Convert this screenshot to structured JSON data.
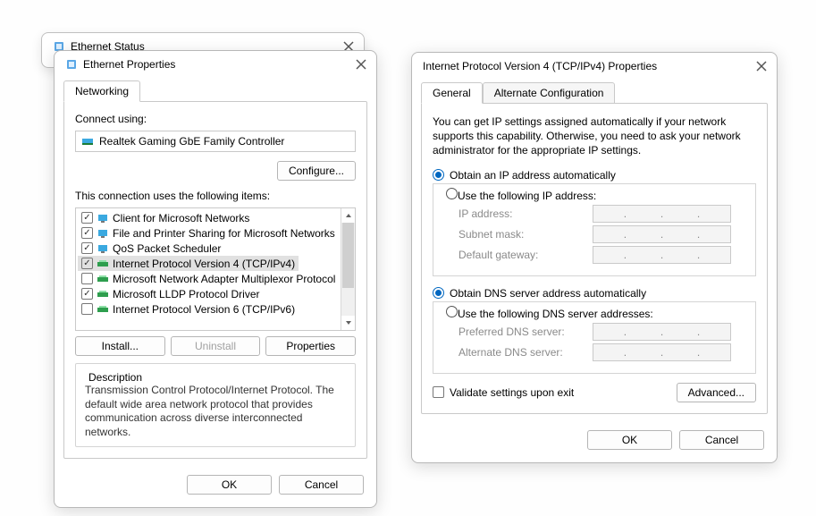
{
  "background_dialog": {
    "title": "Ethernet Status"
  },
  "ethernet": {
    "title": "Ethernet Properties",
    "tab": "Networking",
    "connect_using_label": "Connect using:",
    "adapter": "Realtek Gaming GbE Family Controller",
    "configure_btn": "Configure...",
    "items_label": "This connection uses the following items:",
    "items": [
      {
        "checked": true,
        "label": "Client for Microsoft Networks",
        "icon": "client-icon"
      },
      {
        "checked": true,
        "label": "File and Printer Sharing for Microsoft Networks",
        "icon": "share-icon"
      },
      {
        "checked": true,
        "label": "QoS Packet Scheduler",
        "icon": "qos-icon"
      },
      {
        "checked": true,
        "label": "Internet Protocol Version 4 (TCP/IPv4)",
        "icon": "protocol-icon",
        "selected": true
      },
      {
        "checked": false,
        "label": "Microsoft Network Adapter Multiplexor Protocol",
        "icon": "protocol-icon"
      },
      {
        "checked": true,
        "label": "Microsoft LLDP Protocol Driver",
        "icon": "protocol-icon"
      },
      {
        "checked": false,
        "label": "Internet Protocol Version 6 (TCP/IPv6)",
        "icon": "protocol-icon"
      }
    ],
    "install_btn": "Install...",
    "uninstall_btn": "Uninstall",
    "properties_btn": "Properties",
    "desc_label": "Description",
    "desc": "Transmission Control Protocol/Internet Protocol. The default wide area network protocol that provides communication across diverse interconnected networks.",
    "ok": "OK",
    "cancel": "Cancel"
  },
  "ipv4": {
    "title": "Internet Protocol Version 4 (TCP/IPv4) Properties",
    "tab_general": "General",
    "tab_alt": "Alternate Configuration",
    "info": "You can get IP settings assigned automatically if your network supports this capability. Otherwise, you need to ask your network administrator for the appropriate IP settings.",
    "ip_auto": "Obtain an IP address automatically",
    "ip_manual": "Use the following IP address:",
    "ip_address_label": "IP address:",
    "subnet_label": "Subnet mask:",
    "gateway_label": "Default gateway:",
    "dns_auto": "Obtain DNS server address automatically",
    "dns_manual": "Use the following DNS server addresses:",
    "pref_dns_label": "Preferred DNS server:",
    "alt_dns_label": "Alternate DNS server:",
    "validate": "Validate settings upon exit",
    "advanced": "Advanced...",
    "ok": "OK",
    "cancel": "Cancel"
  }
}
